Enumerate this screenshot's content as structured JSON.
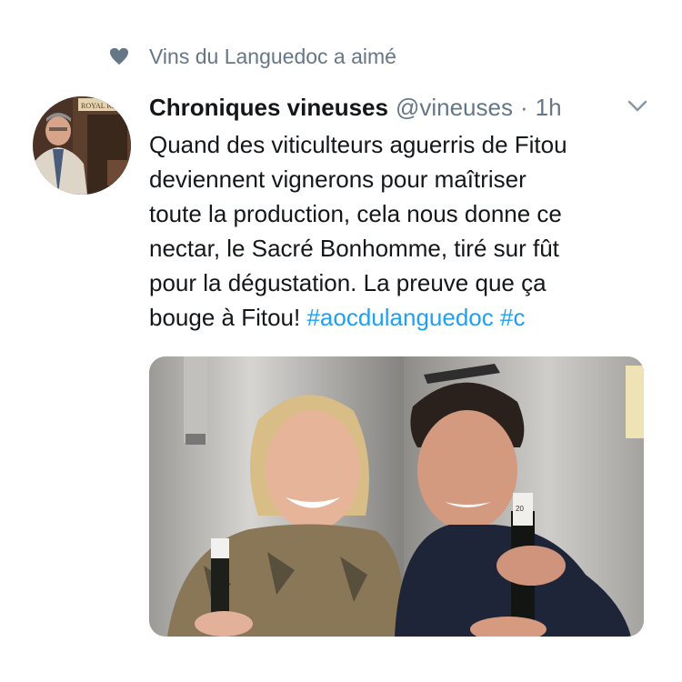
{
  "social_context": {
    "icon": "heart-icon",
    "text": "Vins du Languedoc a aimé"
  },
  "tweet": {
    "display_name": "Chroniques vineuses",
    "handle": "@vineuses",
    "separator": "·",
    "time": "1h",
    "text_lines": [
      "Quand des viticulteurs aguerris de Fitou",
      "deviennent vignerons pour maîtriser",
      "toute la production, cela nous donne ce",
      "nectar, le Sacré Bonhomme, tiré sur fût",
      "pour la dégustation. La preuve que ça"
    ],
    "last_line_prefix": "bouge à Fitou! ",
    "hashtags": [
      "#aocdulanguedoc",
      "#c"
    ],
    "avatar_sign_text": "ROYAL RESE",
    "media_label_text": "20"
  },
  "colors": {
    "text": "#14171a",
    "secondary": "#657786",
    "link": "#1da1f2"
  }
}
